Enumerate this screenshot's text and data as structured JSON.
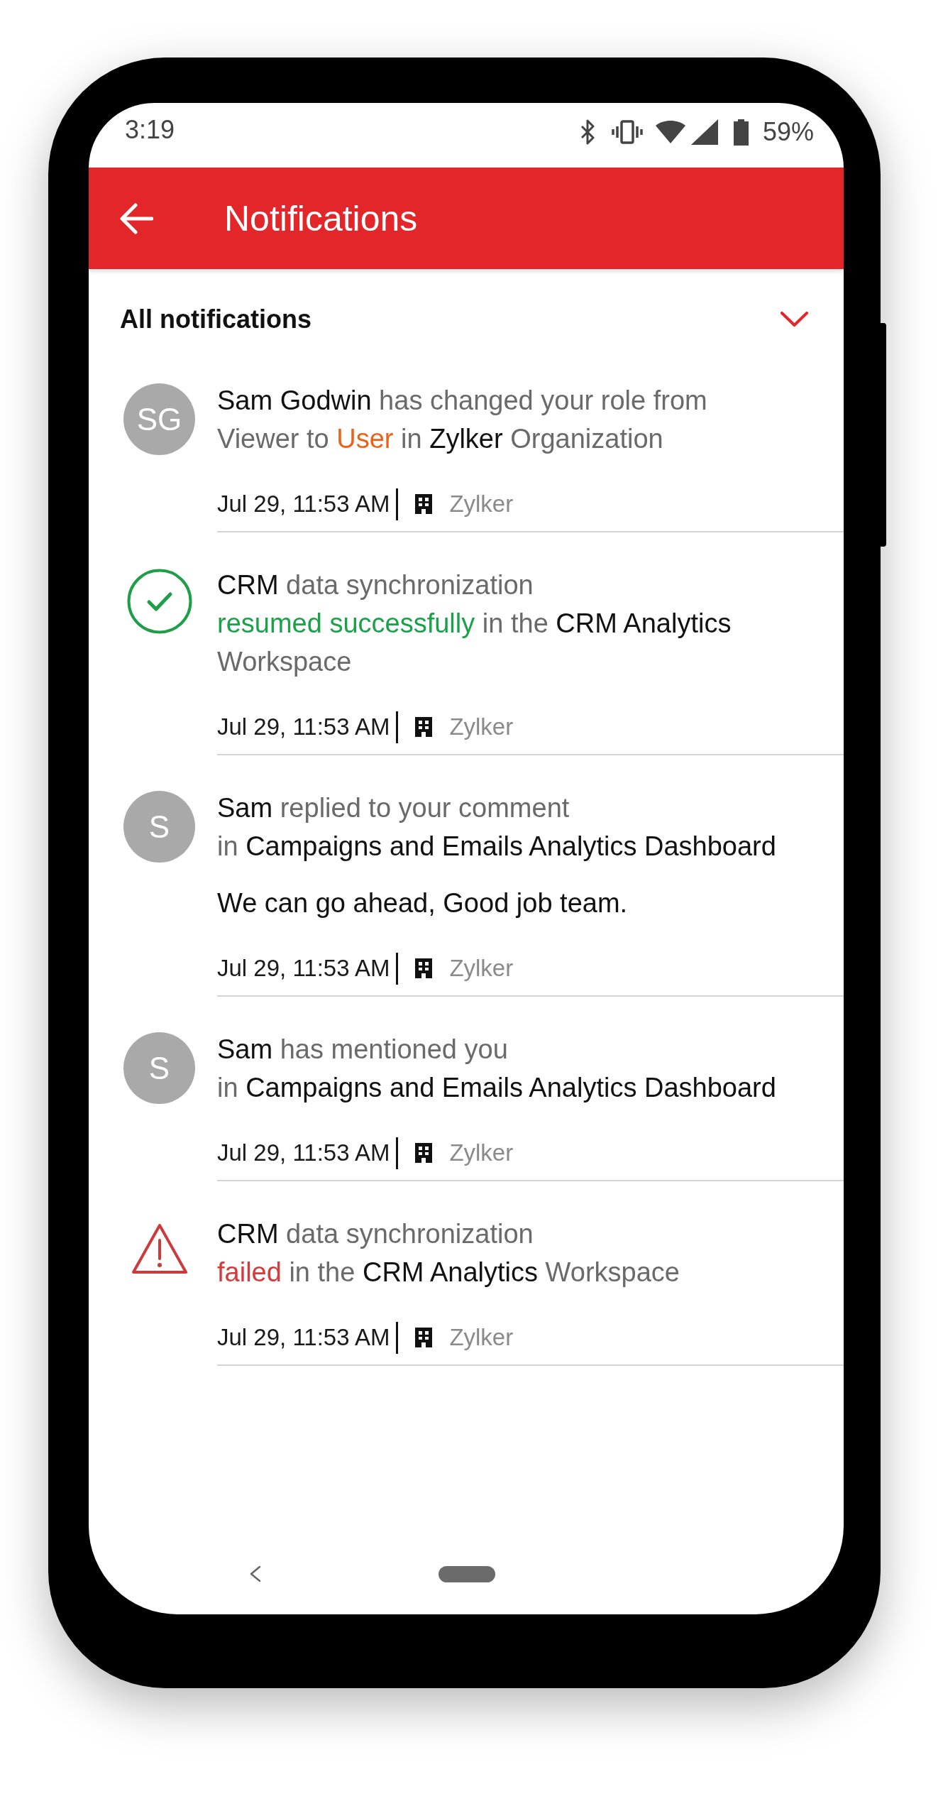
{
  "status_bar": {
    "time": "3:19",
    "battery_text": "59%"
  },
  "app_bar": {
    "title": "Notifications"
  },
  "filter": {
    "label": "All notifications"
  },
  "notifications": [
    {
      "kind": "avatar",
      "initials": "SG",
      "message": [
        [
          {
            "kind": "strong",
            "text": "Sam Godwin"
          },
          {
            "kind": "muted",
            "text": "has changed your role from"
          }
        ],
        [
          {
            "kind": "muted",
            "text": "Viewer to"
          },
          {
            "kind": "accent",
            "color": "#e8641b",
            "text": "User"
          },
          {
            "kind": "muted",
            "text": "in"
          },
          {
            "kind": "strong",
            "text": "Zylker"
          },
          {
            "kind": "muted",
            "text": "Organization"
          }
        ]
      ],
      "time": "Jul 29, 11:53 AM",
      "organization": "Zylker"
    },
    {
      "kind": "success",
      "message": [
        [
          {
            "kind": "strong",
            "text": "CRM"
          },
          {
            "kind": "muted",
            "text": "data synchronization"
          }
        ],
        [
          {
            "kind": "accent",
            "color": "#1ba14b",
            "text": "resumed successfully"
          },
          {
            "kind": "muted",
            "text": "in the"
          },
          {
            "kind": "strong",
            "text": "CRM Analytics"
          }
        ],
        [
          {
            "kind": "muted",
            "text": "Workspace"
          }
        ]
      ],
      "time": "Jul 29, 11:53 AM",
      "organization": "Zylker"
    },
    {
      "kind": "avatar",
      "initials": "S",
      "message": [
        [
          {
            "kind": "strong",
            "text": "Sam"
          },
          {
            "kind": "muted",
            "text": "replied to your comment"
          }
        ],
        [
          {
            "kind": "muted",
            "text": "in"
          },
          {
            "kind": "strong",
            "text": "Campaigns and Emails Analytics Dashboard"
          }
        ]
      ],
      "comment": "We can go ahead, Good job team.",
      "time": "Jul 29, 11:53 AM",
      "organization": "Zylker"
    },
    {
      "kind": "avatar",
      "initials": "S",
      "message": [
        [
          {
            "kind": "strong",
            "text": "Sam"
          },
          {
            "kind": "muted",
            "text": "has mentioned you"
          }
        ],
        [
          {
            "kind": "muted",
            "text": "in"
          },
          {
            "kind": "strong",
            "text": "Campaigns and Emails Analytics Dashboard"
          }
        ]
      ],
      "time": "Jul 29, 11:53 AM",
      "organization": "Zylker"
    },
    {
      "kind": "warning",
      "message": [
        [
          {
            "kind": "strong",
            "text": "CRM"
          },
          {
            "kind": "muted",
            "text": "data synchronization"
          }
        ],
        [
          {
            "kind": "accent",
            "color": "#d23c3c",
            "text": "failed"
          },
          {
            "kind": "muted",
            "text": "in the"
          },
          {
            "kind": "strong",
            "text": "CRM Analytics"
          },
          {
            "kind": "muted",
            "text": "Workspace"
          }
        ]
      ],
      "time": "Jul 29, 11:53 AM",
      "organization": "Zylker"
    }
  ]
}
